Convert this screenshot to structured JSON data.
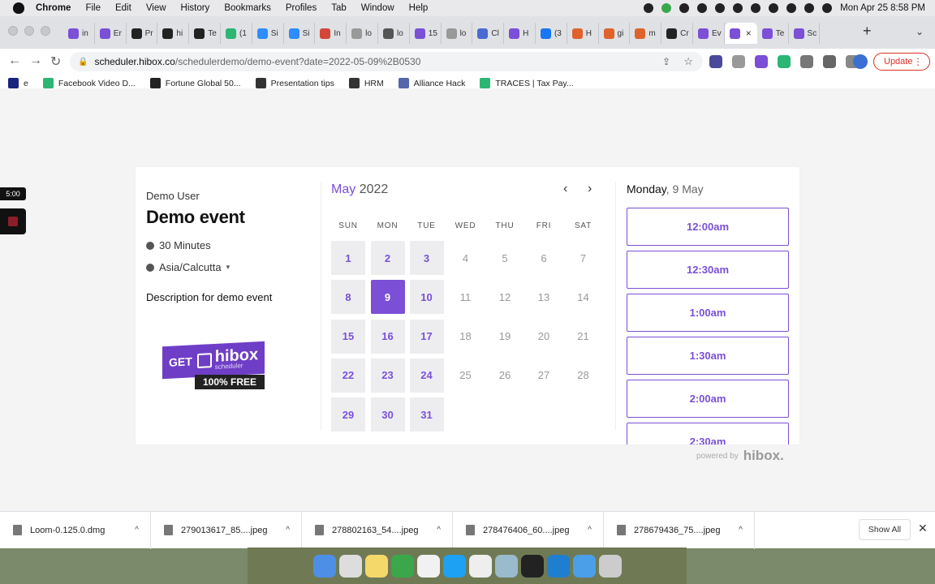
{
  "menubar": {
    "app": "Chrome",
    "items": [
      "File",
      "Edit",
      "View",
      "History",
      "Bookmarks",
      "Profiles",
      "Tab",
      "Window",
      "Help"
    ],
    "datetime": "Mon Apr 25  8:58 PM"
  },
  "tabs": [
    {
      "label": "in",
      "color": "#7b4fd6"
    },
    {
      "label": "Er",
      "color": "#7b4fd6"
    },
    {
      "label": "Pr",
      "color": "#222"
    },
    {
      "label": "hi",
      "color": "#222"
    },
    {
      "label": "Te",
      "color": "#222"
    },
    {
      "label": "(1",
      "color": "#2bb673"
    },
    {
      "label": "Si",
      "color": "#2d8cff"
    },
    {
      "label": "Si",
      "color": "#2d8cff"
    },
    {
      "label": "In",
      "color": "#d44638"
    },
    {
      "label": "lo",
      "color": "#999"
    },
    {
      "label": "lo",
      "color": "#555"
    },
    {
      "label": "15",
      "color": "#7b4fd6"
    },
    {
      "label": "lo",
      "color": "#999"
    },
    {
      "label": "Cl",
      "color": "#4a6cd1"
    },
    {
      "label": "H",
      "color": "#7b4fd6"
    },
    {
      "label": "(3",
      "color": "#1877f2"
    },
    {
      "label": "H",
      "color": "#e0622b"
    },
    {
      "label": "gi",
      "color": "#e0622b"
    },
    {
      "label": "m",
      "color": "#e0622b"
    },
    {
      "label": "Cr",
      "color": "#222"
    },
    {
      "label": "Ev",
      "color": "#7b4fd6"
    },
    {
      "label": "",
      "color": "#7b4fd6",
      "active": true
    },
    {
      "label": "Te",
      "color": "#7b4fd6"
    },
    {
      "label": "Sc",
      "color": "#7b4fd6"
    }
  ],
  "address": {
    "host": "scheduler.hibox.co",
    "path": "/schedulerdemo/demo-event?date=2022-05-09%2B0530"
  },
  "update_label": "Update",
  "bookmarks": [
    {
      "label": "e",
      "color": "#1a237e"
    },
    {
      "label": "Facebook Video D...",
      "color": "#2bb673"
    },
    {
      "label": "Fortune Global 50...",
      "color": "#222"
    },
    {
      "label": "Presentation tips",
      "color": "#333"
    },
    {
      "label": "HRM",
      "color": "#333"
    },
    {
      "label": "Alliance Hack",
      "color": "#5566aa"
    },
    {
      "label": "TRACES | Tax Pay...",
      "color": "#2bb673"
    }
  ],
  "recorder": {
    "timer": "5:00"
  },
  "event": {
    "user": "Demo User",
    "name": "Demo event",
    "duration": "30 Minutes",
    "timezone": "Asia/Calcutta",
    "description": "Description for demo event",
    "promo": {
      "get": "GET",
      "brand": "hibox",
      "sub": "scheduler",
      "free": "100% FREE"
    }
  },
  "calendar": {
    "month": "May",
    "year": "2022",
    "weekdays": [
      "SUN",
      "MON",
      "TUE",
      "WED",
      "THU",
      "FRI",
      "SAT"
    ],
    "selected": 9,
    "available": [
      1,
      2,
      3,
      8,
      9,
      10,
      15,
      16,
      17,
      22,
      23,
      24,
      29,
      30,
      31
    ],
    "days": [
      1,
      2,
      3,
      4,
      5,
      6,
      7,
      8,
      9,
      10,
      11,
      12,
      13,
      14,
      15,
      16,
      17,
      18,
      19,
      20,
      21,
      22,
      23,
      24,
      25,
      26,
      27,
      28,
      29,
      30,
      31
    ]
  },
  "slots": {
    "day": "Monday",
    "date": ", 9 May",
    "times": [
      "12:00am",
      "12:30am",
      "1:00am",
      "1:30am",
      "2:00am",
      "2:30am"
    ]
  },
  "powered": {
    "label": "powered by",
    "brand": "hibox."
  },
  "downloads": {
    "files": [
      "Loom-0.125.0.dmg",
      "279013617_85....jpeg",
      "278802163_54....jpeg",
      "278476406_60....jpeg",
      "278679436_75....jpeg"
    ],
    "show_all": "Show All"
  }
}
